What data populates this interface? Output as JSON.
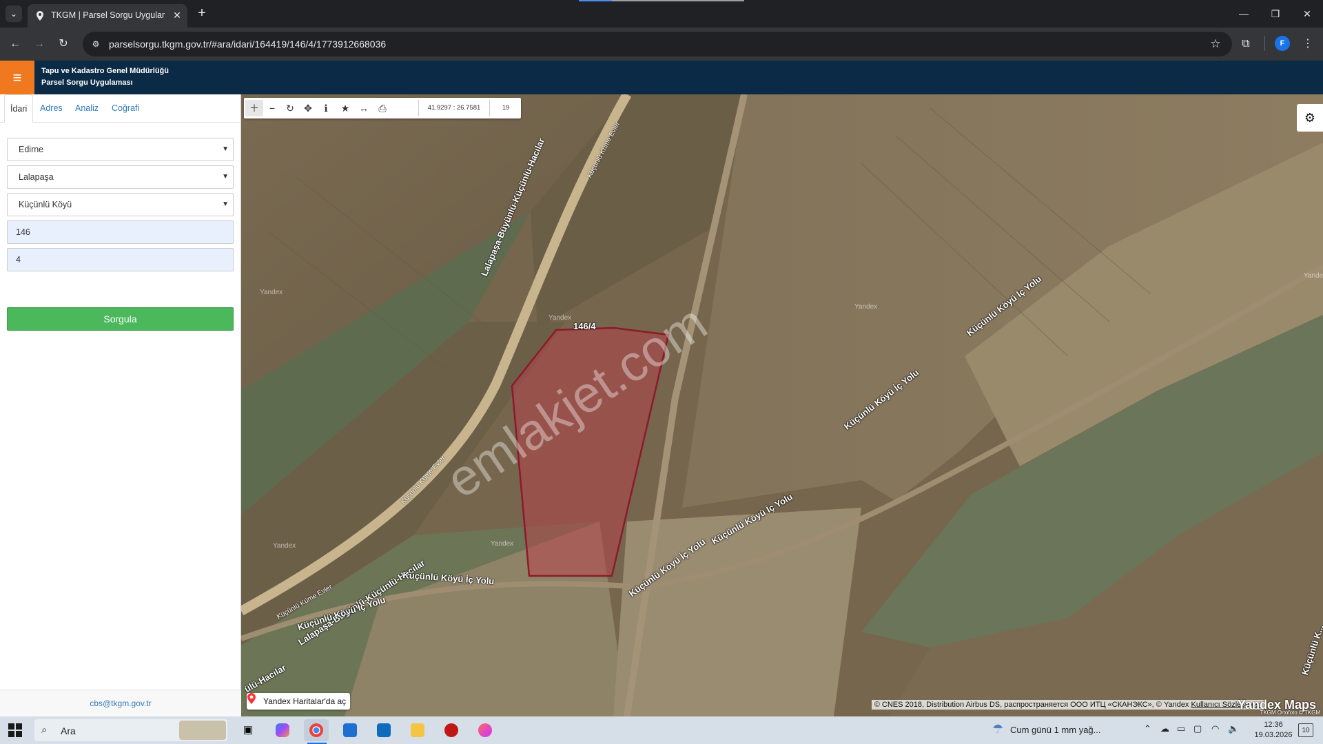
{
  "browser": {
    "tab_title": "TKGM | Parsel Sorgu Uygulaması",
    "url": "parselsorgu.tkgm.gov.tr/#ara/idari/164419/146/4/1773912668036",
    "profile_initial": "F"
  },
  "header": {
    "line1": "Tapu ve Kadastro Genel Müdürlüğü",
    "line2": "Parsel Sorgu Uygulaması"
  },
  "sidebar": {
    "tabs": [
      "İdari",
      "Adres",
      "Analiz",
      "Coğrafi"
    ],
    "active_tab": "İdari",
    "il": "Edirne",
    "ilce": "Lalapaşa",
    "mahalle": "Küçünlü Köyü",
    "ada": "146",
    "parsel": "4",
    "query_button": "Sorgula",
    "footer_email": "cbs@tkgm.gov.tr"
  },
  "map": {
    "coordinates": "41.9297 : 26.7581",
    "zoom": "19",
    "parcel_label": "146/4",
    "watermark": "emlakjet.com",
    "road_labels": {
      "main_road_north": "Lalapaşa-Büyünlü-Küçünlü-Hacılar",
      "main_road_south": "Lalapaşa-Büyünlü-Küçünlü-Hacılar",
      "main_road_edge": "ülü-Hacılar",
      "kume_evler_north": "Küçünlü Küme Evler",
      "kume_evler_mid": "Küçünlü Küme Evler",
      "kume_evler_south": "Küçünlü Küme Evler",
      "ic_yolu_a": "Küçünlü Köyü İç Yolu",
      "ic_yolu_b": "Küçünlü Köyü İç Yolu",
      "ic_yolu_c": "Küçünlü Köyü İç Yolu",
      "ic_yolu_d": "Küçünlü Köyü İç Yolu",
      "ic_yolu_e": "Küçünlü Köyü İç Yolu",
      "ic_yolu_f": "Küçünlü Köyü İç Yolu",
      "ic_yolu_right_edge": "Küçünlü K..."
    },
    "tile_watermarks": [
      "Yandex",
      "Yandex",
      "Yandex",
      "Yandex",
      "Yandex",
      "Yande"
    ],
    "open_in_yandex": "Yandex Haritalar'da aç",
    "attribution": "© CNES 2018, Distribution Airbus DS, распространяется ООО ИТЦ «СКАНЭКС», © Yandex",
    "attribution_link": "Kullanıcı Sözleşmesi",
    "logo": "Yandex Maps",
    "ortofoto_credit": "TKGM Ortofoto © TKGM"
  },
  "taskbar": {
    "search_placeholder": "Ara",
    "weather": "Cum günü 1 mm yağ...",
    "time": "12:36",
    "date": "19.03.2026",
    "notifications": "10"
  },
  "colors": {
    "header_bg": "#0a2a45",
    "burger": "#f0791f",
    "query_button": "#4cb85c",
    "parcel_stroke": "#8b1a2b",
    "parcel_fill": "#c23a4a"
  }
}
